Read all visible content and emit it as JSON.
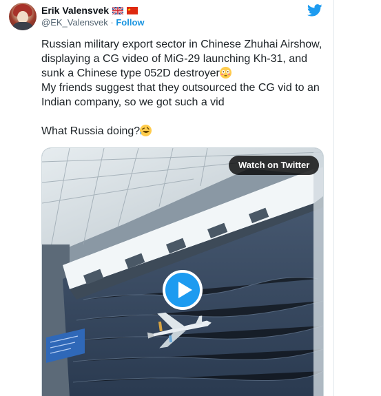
{
  "tweet": {
    "author": {
      "display_name": "Erik Valensvek",
      "handle": "@EK_Valensvek",
      "separator": " · ",
      "follow_label": "Follow",
      "flags": [
        "uk-flag-icon",
        "china-flag-icon"
      ]
    },
    "brand_icon": "twitter-bird-icon",
    "text": {
      "line1": "Russian military export sector in Chinese Zhuhai Airshow, displaying a CG video of MiG-29 launching Kh-31, and sunk a Chinese type 052D destroyer",
      "emoji1": "flushed-face-emoji",
      "line2": "My friends suggest that they outsourced the CG vid to an Indian company, so we got such a vid",
      "line3": "What Russia doing?",
      "emoji2": "rolling-laughing-emoji"
    },
    "media": {
      "watch_label": "Watch on Twitter",
      "play_icon": "play-icon"
    }
  },
  "colors": {
    "accent": "#1d9bf0",
    "link": "#1b95e0",
    "secondary_text": "#536471"
  }
}
